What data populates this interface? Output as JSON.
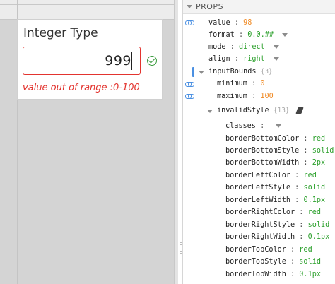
{
  "component": {
    "title": "Integer Type",
    "value": "999",
    "error": "value out of range :0-100"
  },
  "panel": {
    "title": "PROPS",
    "props": {
      "value": {
        "key": "value",
        "sep": ":",
        "val": "98"
      },
      "format": {
        "key": "format",
        "sep": ":",
        "val": "0.0.##"
      },
      "mode": {
        "key": "mode",
        "sep": ":",
        "val": "direct"
      },
      "align": {
        "key": "align",
        "sep": ":",
        "val": "right"
      },
      "inputBounds": {
        "key": "inputBounds",
        "count": "{3}"
      },
      "minimum": {
        "key": "minimum",
        "sep": ":",
        "val": "0"
      },
      "maximum": {
        "key": "maximum",
        "sep": ":",
        "val": "100"
      },
      "invalidStyle": {
        "key": "invalidStyle",
        "count": "{13}"
      },
      "classes": {
        "key": "classes",
        "sep": ":"
      },
      "borderBottomColor": {
        "key": "borderBottomColor",
        "sep": ":",
        "val": "red"
      },
      "borderBottomStyle": {
        "key": "borderBottomStyle",
        "sep": ":",
        "val": "solid"
      },
      "borderBottomWidth": {
        "key": "borderBottomWidth",
        "sep": ":",
        "val": "2px"
      },
      "borderLeftColor": {
        "key": "borderLeftColor",
        "sep": ":",
        "val": "red"
      },
      "borderLeftStyle": {
        "key": "borderLeftStyle",
        "sep": ":",
        "val": "solid"
      },
      "borderLeftWidth": {
        "key": "borderLeftWidth",
        "sep": ":",
        "val": "0.1px"
      },
      "borderRightColor": {
        "key": "borderRightColor",
        "sep": ":",
        "val": "red"
      },
      "borderRightStyle": {
        "key": "borderRightStyle",
        "sep": ":",
        "val": "solid"
      },
      "borderRightWidth": {
        "key": "borderRightWidth",
        "sep": ":",
        "val": "0.1px"
      },
      "borderTopColor": {
        "key": "borderTopColor",
        "sep": ":",
        "val": "red"
      },
      "borderTopStyle": {
        "key": "borderTopStyle",
        "sep": ":",
        "val": "solid"
      },
      "borderTopWidth": {
        "key": "borderTopWidth",
        "sep": ":",
        "val": "0.1px"
      }
    }
  },
  "icons": {
    "link": "link-icon",
    "check": "check-circle-icon",
    "dropdown": "chevron-down-icon",
    "expand": "expand-triangle-icon",
    "style": "paintbrush-icon"
  },
  "colors": {
    "error": "#e3342f",
    "valid": "#3a9b3e",
    "string_value": "#2ca02c",
    "number_value": "#f08a24",
    "binding": "#4b90e2"
  }
}
